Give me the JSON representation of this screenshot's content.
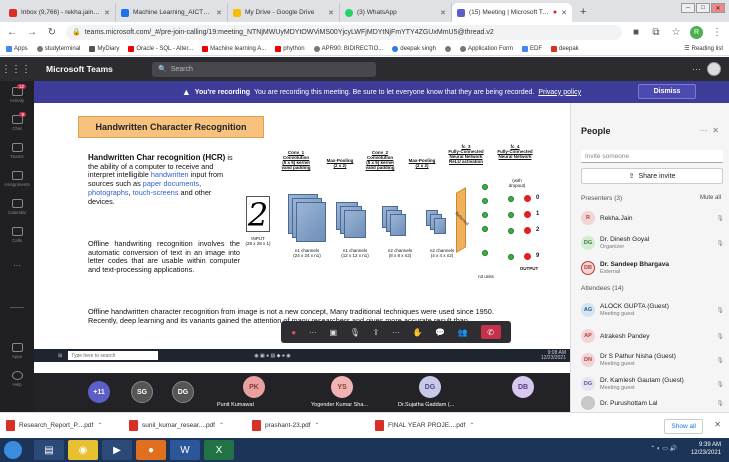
{
  "browser": {
    "tabs": [
      {
        "label": "Inbox (9,766) - rekha.jain@poorn",
        "fav_color": "#d93025"
      },
      {
        "label": "Machine Learning_AICTE-ISTE - (",
        "fav_color": "#1a73e8"
      },
      {
        "label": "My Drive - Google Drive",
        "fav_color": "#fbbc04"
      },
      {
        "label": "(3) WhatsApp",
        "fav_color": "#25d366"
      },
      {
        "label": "(15) Meeting | Microsoft Tea",
        "fav_color": "#5b5fc7",
        "active": true
      }
    ],
    "new_tab": "+",
    "url": "teams.microsoft.com/_#/pre-join-calling/19:meeting_NTNjMWUyMDYtOWViMS00YjcyLWFjMDYtNjFmYTY4ZGUxMmU5@thread.v2",
    "profile_initial": "R",
    "bookmarks": [
      "Apps",
      "studyterminal",
      "MyDiary",
      "Oracle - SQL - Alter...",
      "Machine learning A...",
      "phython",
      "APR90: BIDIRECTIO...",
      "deepak singh",
      "",
      "Application Form",
      "EDF",
      "deepak"
    ],
    "reading_list": "Reading list"
  },
  "teams": {
    "app_name": "Microsoft Teams",
    "search_placeholder": "Search",
    "rail": [
      {
        "label": "Activity",
        "badge": "12"
      },
      {
        "label": "Chat",
        "badge": "9"
      },
      {
        "label": "Teams",
        "badge": ""
      },
      {
        "label": "Assignments",
        "badge": ""
      },
      {
        "label": "Calendar",
        "badge": ""
      },
      {
        "label": "Calls",
        "badge": ""
      },
      {
        "label": "...",
        "badge": ""
      },
      {
        "label": "",
        "badge": ""
      },
      {
        "label": "Apps",
        "badge": ""
      },
      {
        "label": "Help",
        "badge": ""
      }
    ],
    "banner": {
      "bold": "You're recording",
      "text": "You are recording this meeting. Be sure to let everyone know that they are being recorded.",
      "link": "Privacy policy",
      "dismiss": "Dismiss"
    }
  },
  "slide": {
    "title": "Handwritten Character Recognition",
    "p1_bold": "Handwritten Char recognition (HCR)",
    "p1_a": " is the ability of a computer to receive and interpret intelligible ",
    "p1_link1": "handwritten",
    "p1_b": " input from sources such as ",
    "p1_link2": "paper documents",
    "p1_c": ", ",
    "p1_link3": "photographs",
    "p1_d": ", ",
    "p1_link4": "touch-screens",
    "p1_e": " and other devices.",
    "p2": "Offline handwriting recognition involves the automatic conversion of text in an image into letter codes that are usable within computer and text-processing applications.",
    "p3": "Offline handwritten character recognition from image is not a new concept, Many traditional techniques were used since 1950. Recently, deep learning and its variants gained the attention of many researchers and gives more accurate result than",
    "diagram": {
      "conv1": "Conv_1\nConvolution\n(5 x 5) kernel\nvalid padding",
      "pool1": "Max-Pooling\n(2 x 2)",
      "conv2": "Conv_2\nConvolution\n(5 x 5) kernel\nvalid padding",
      "pool2": "Max-Pooling\n(2 x 2)",
      "fc3": "fc_3\nFully-Connected\nNeural Network\nReLU activation",
      "fc4": "fc_4\nFully-Connected\nNeural Network",
      "dropout": "(with\ndropout)",
      "input_char": "2",
      "input_label": "INPUT\n(28 x 28 x 1)",
      "l1": "n1 channels\n(24 x 24 x n1)",
      "l2": "n1 channels\n(12 x 12 x n1)",
      "l3": "n2 channels\n(8 x 8 x n2)",
      "l4": "n2 channels\n(4 x 4 x n2)",
      "flatten": "flattened",
      "units": "n3 units",
      "output_label": "OUTPUT",
      "outputs": [
        "0",
        "1",
        "2",
        "9"
      ]
    }
  },
  "presenter": {
    "name": "Dr. Sandeep Bhargava",
    "taskbar_search": "Type here to search",
    "time": "9:08 AM",
    "date": "12/23/2021"
  },
  "controls": [
    "record-dot",
    "dots",
    "camera-off",
    "mic-off",
    "share",
    "more",
    "raise-hand",
    "chat",
    "participants",
    "hangup"
  ],
  "gallery": [
    {
      "initials": "+11",
      "color": "#5b5fc7",
      "name": ""
    },
    {
      "initials": "SG",
      "color": "#5a5a5a",
      "name": ""
    },
    {
      "initials": "DG",
      "color": "#5a5a5a",
      "name": ""
    },
    {
      "initials": "PK",
      "color": "#e8a0a0",
      "name": "Punit Kumawat"
    },
    {
      "initials": "YS",
      "color": "#f0b4b4",
      "name": "Yogender Kumar Sha..."
    },
    {
      "initials": "DG",
      "color": "#c8c8e8",
      "name": "Dr.Sujatha Gaddam (..."
    },
    {
      "initials": "DB",
      "color": "#d8c8f0",
      "name": ""
    }
  ],
  "people": {
    "title": "People",
    "invite_placeholder": "Invite someone",
    "share_invite": "Share invite",
    "presenters_label": "Presenters (3)",
    "mute_all": "Mute all",
    "presenters": [
      {
        "initials": "R",
        "name": "Rekha.Jain",
        "role": "",
        "bg": "#f3d4d4",
        "fg": "#b04040"
      },
      {
        "initials": "DG",
        "name": "Dr. Dinesh Goyal",
        "role": "Organizer",
        "bg": "#d4ecd4",
        "fg": "#3a7a3a"
      },
      {
        "initials": "DB",
        "name": "Dr. Sandeep Bhargava",
        "role": "External",
        "bg": "#f3d4d4",
        "fg": "#b04040",
        "bold": true
      }
    ],
    "attendees_label": "Attendees (14)",
    "attendees": [
      {
        "initials": "AG",
        "name": "ALOCK GUPTA (Guest)",
        "role": "Meeting guest",
        "bg": "#d4e4f3",
        "fg": "#3a5a8a"
      },
      {
        "initials": "AP",
        "name": "Atrakesh Pandey",
        "role": "",
        "bg": "#f3d4d4",
        "fg": "#b04040"
      },
      {
        "initials": "DN",
        "name": "Dr S Pathur Nisha (Guest)",
        "role": "Meeting guest",
        "bg": "#f3d4d4",
        "fg": "#b04040"
      },
      {
        "initials": "DG",
        "name": "Dr. Kamlesh Gautam (Guest)",
        "role": "Meeting guest",
        "bg": "#e4e4f3",
        "fg": "#5a5a8a"
      },
      {
        "initials": "",
        "name": "Dr. Purushottam Lal",
        "role": "",
        "bg": "#d0d0d0",
        "fg": "#555"
      }
    ]
  },
  "downloads": [
    {
      "label": "Research_Report_P....pdf"
    },
    {
      "label": "sunil_kumar_resear....pdf"
    },
    {
      "label": "prashant-23.pdf"
    },
    {
      "label": "FINAL YEAR PROJE....pdf"
    }
  ],
  "show_all": "Show all",
  "taskbar": {
    "time": "9:39 AM",
    "date": "12/23/2021"
  }
}
